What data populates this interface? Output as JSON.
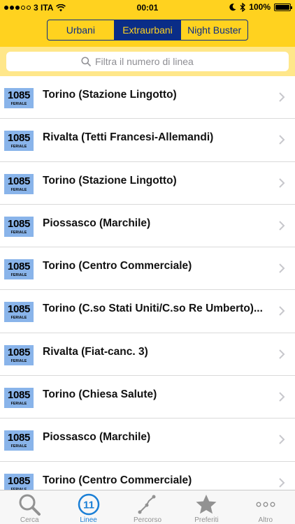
{
  "status_bar": {
    "carrier": "3 ITA",
    "time": "00:01",
    "battery": "100%"
  },
  "segments": [
    {
      "label": "Urbani",
      "active": false
    },
    {
      "label": "Extraurbani",
      "active": true
    },
    {
      "label": "Night Buster",
      "active": false
    }
  ],
  "search": {
    "placeholder": "Filtra il numero di linea"
  },
  "lines": [
    {
      "number": "1085",
      "type": "FERIALE",
      "destination": "Torino (Stazione Lingotto)"
    },
    {
      "number": "1085",
      "type": "FERIALE",
      "destination": "Rivalta (Tetti Francesi-Allemandi)"
    },
    {
      "number": "1085",
      "type": "FERIALE",
      "destination": "Torino (Stazione Lingotto)"
    },
    {
      "number": "1085",
      "type": "FERIALE",
      "destination": "Piossasco (Marchile)"
    },
    {
      "number": "1085",
      "type": "FERIALE",
      "destination": "Torino (Centro Commerciale)"
    },
    {
      "number": "1085",
      "type": "FERIALE",
      "destination": "Torino (C.so Stati Uniti/C.so Re Umberto)..."
    },
    {
      "number": "1085",
      "type": "FERIALE",
      "destination": "Rivalta (Fiat-canc. 3)"
    },
    {
      "number": "1085",
      "type": "FERIALE",
      "destination": "Torino (Chiesa Salute)"
    },
    {
      "number": "1085",
      "type": "FERIALE",
      "destination": "Piossasco (Marchile)"
    },
    {
      "number": "1085",
      "type": "FERIALE",
      "destination": "Torino (Centro Commerciale)"
    }
  ],
  "tabs": [
    {
      "label": "Cerca",
      "icon": "search-icon"
    },
    {
      "label": "Linee",
      "icon": "lines-icon",
      "badge": "11"
    },
    {
      "label": "Percorso",
      "icon": "route-icon"
    },
    {
      "label": "Preferiti",
      "icon": "star-icon"
    },
    {
      "label": "Altro",
      "icon": "more-icon"
    }
  ],
  "colors": {
    "header_yellow": "#FFD21F",
    "search_yellow": "#FFE78A",
    "navy": "#0A2D87",
    "badge_blue": "#89B4EA",
    "tab_active": "#1A7FD6",
    "tab_inactive": "#929292"
  }
}
